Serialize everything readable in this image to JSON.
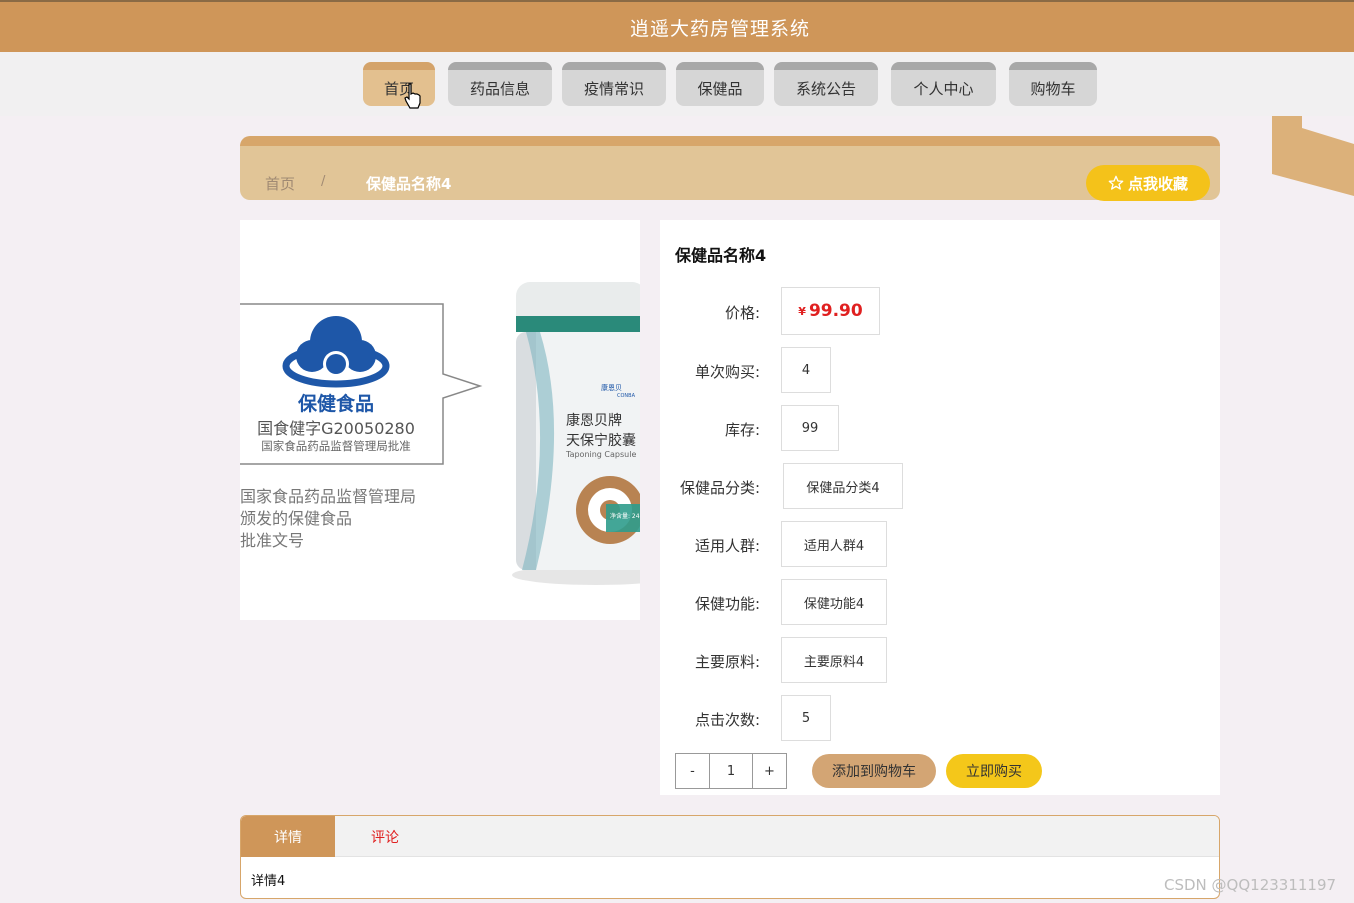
{
  "header": {
    "title": "逍遥大药房管理系统"
  },
  "nav": {
    "items": [
      {
        "label": "首页"
      },
      {
        "label": "药品信息"
      },
      {
        "label": "疫情常识"
      },
      {
        "label": "保健品"
      },
      {
        "label": "系统公告"
      },
      {
        "label": "个人中心"
      },
      {
        "label": "购物车"
      }
    ]
  },
  "breadcrumb": {
    "home": "首页",
    "separator": "/",
    "current": "保健品名称4"
  },
  "favorite_button": "点我收藏",
  "product_image": {
    "seal_title": "保健食品",
    "approval_no": "国食健字G20050280",
    "approval_org": "国家食品药品监督管理局批准",
    "caption_line1": "国家食品药品监督管理局",
    "caption_line2": "颁发的保健食品",
    "caption_line3": "批准文号",
    "brand_logo": "康恩贝",
    "brand_en": "CONBA",
    "product_line1": "康恩贝牌",
    "product_line2": "天保宁胶囊",
    "product_en": "Taponing Capsule",
    "net_content": "净含量: 24"
  },
  "product": {
    "name": "保健品名称4",
    "price_label": "价格:",
    "price_currency": "¥",
    "price": "99.90",
    "single_purchase_label": "单次购买:",
    "single_purchase": "4",
    "stock_label": "库存:",
    "stock": "99",
    "category_label": "保健品分类:",
    "category": "保健品分类4",
    "audience_label": "适用人群:",
    "audience": "适用人群4",
    "function_label": "保健功能:",
    "function": "保健功能4",
    "ingredients_label": "主要原料:",
    "ingredients": "主要原料4",
    "clicks_label": "点击次数:",
    "clicks": "5"
  },
  "quantity": {
    "minus": "-",
    "value": "1",
    "plus": "+"
  },
  "actions": {
    "add_to_cart": "添加到购物车",
    "buy_now": "立即购买"
  },
  "tabs": {
    "details": "详情",
    "comments": "评论",
    "details_content": "详情4"
  },
  "watermark": "CSDN @QQ123311197",
  "colors": {
    "primary": "#cf9659",
    "accent_yellow": "#f4c21a",
    "price_red": "#e02020"
  }
}
